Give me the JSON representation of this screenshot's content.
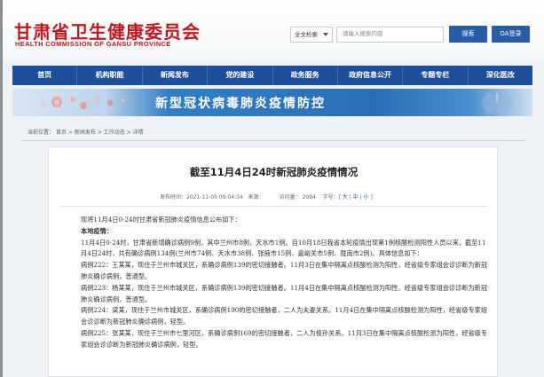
{
  "header": {
    "logo_cn": "甘肃省卫生健康委员会",
    "logo_en": "HEALTH  COMMISSION  OF  GANSU PROVINCE",
    "search": {
      "scope_value": "全文检索",
      "placeholder": "请输入搜索内容",
      "button_label": "搜索",
      "oa_label": "OA登录"
    }
  },
  "nav": {
    "items": [
      "首页",
      "机构职能",
      "新闻发布",
      "党的建设",
      "政务服务",
      "政府信息公开",
      "专题专栏",
      "深化医改"
    ]
  },
  "banner": {
    "text": "新型冠状病毒肺炎疫情防控"
  },
  "breadcrumb": {
    "label": "当前位置：",
    "items": [
      "首页",
      "新闻发布",
      "工作动态",
      "详情"
    ],
    "separator": ">"
  },
  "article": {
    "title": "截至11月4日24时新冠肺炎疫情情况",
    "meta": {
      "published_label": "发布时间：",
      "published_value": "2021-11-05 09:04:34",
      "source_label": "来源：",
      "views_label": "访问量：",
      "views_value": "2984",
      "font_size_label": "字号：",
      "size_large": "大",
      "size_medium": "中",
      "size_small": "小"
    },
    "paragraphs": [
      "现将11月4日0-24时甘肃省新冠肺炎疫情信息公布如下：",
      "本地疫情：",
      "11月4日0-24时，甘肃省新增确诊病例9例，其中兰州市8例，天水市1例。自10月18日我省本轮疫情出现第1例核酸检测阳性人员以来，截至11月4日24时，共有确诊病例134例(兰州市74例、天水市38例、张掖市15例、嘉峪关市5例、陇南市2例)。具体信息如下：",
      "病例222：王某某，现住于兰州市城关区，系确诊病例139的密切接触者。11月3日在集中隔离点核酸检测为阳性，经省级专家组会诊诊断为新冠肺炎确诊病例，普通型。",
      "病例223：杨某某，现住于兰州市城关区，系确诊病例139的密切接触者。11月4日在集中隔离点核酸检测为阳性，经省级专家组会诊诊断为新冠肺炎确诊病例，普通型。",
      "病例224：梁某，现住于兰州市城关区，系确诊病例190的密切接触者，二人为夫妻关系。11月4日在集中隔离点核酸检测为阳性，经省级专家组会诊诊断为新冠肺炎确诊病例，轻型。",
      "病例225：张某某，现住于兰州市七里河区，系确诊病例169的密切接触者，二人为祖孙关系。11月3日在集中隔离点核酸检测为阳性，经省级专家组会诊诊断为新冠肺炎确诊病例，轻型。"
    ]
  },
  "colors": {
    "brand_red": "#c9151e",
    "nav_blue": "#1e4f9a",
    "button_blue": "#2a5ca8"
  }
}
